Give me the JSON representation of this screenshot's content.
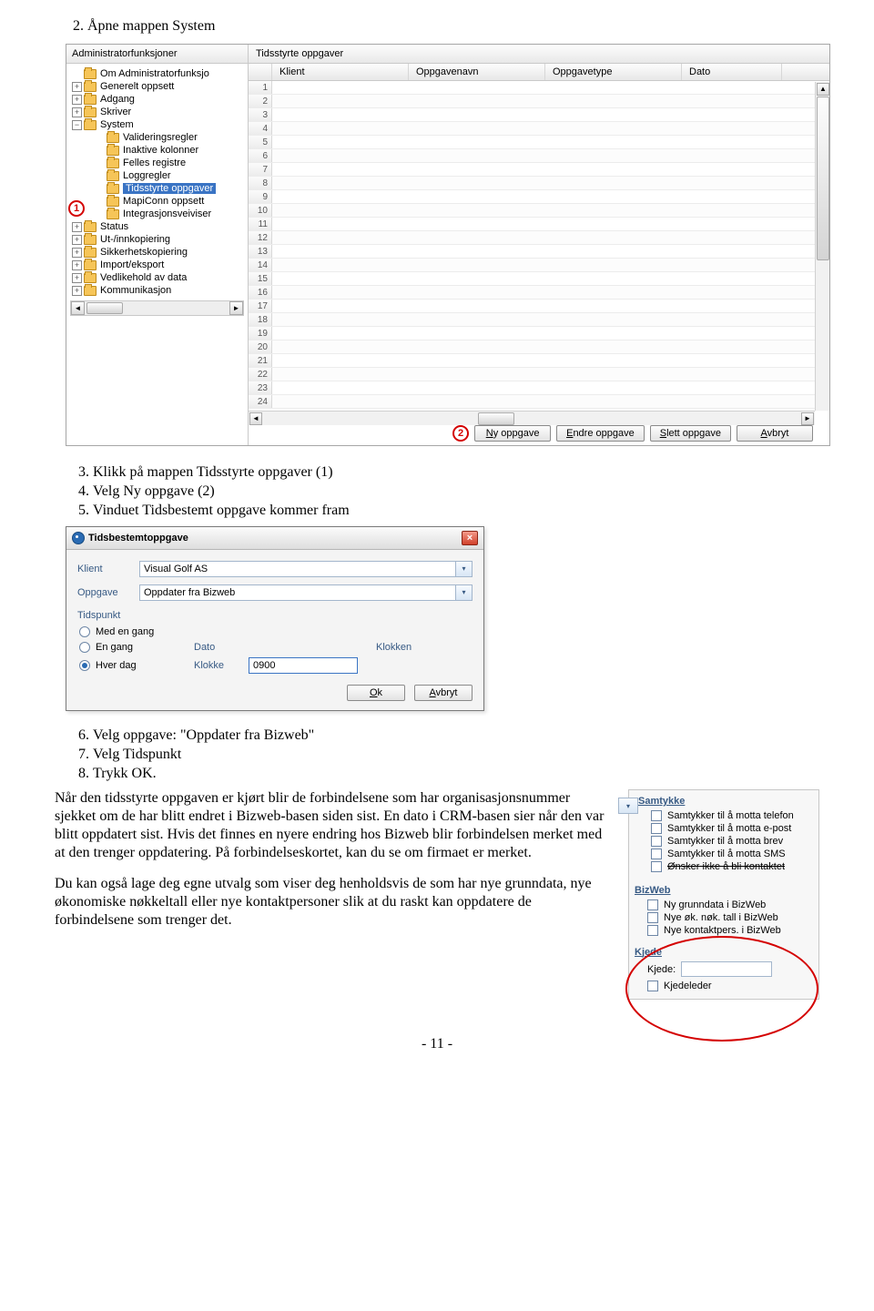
{
  "steps": {
    "s2": "2.   Åpne mappen System",
    "s3": "Klikk på mappen Tidsstyrte oppgaver (1)",
    "s4": "Velg Ny oppgave (2)",
    "s5": "Vinduet Tidsbestemt oppgave kommer fram",
    "s6": "Velg oppgave: \"Oppdater fra Bizweb\"",
    "s7": "Velg Tidspunkt",
    "s8": "Trykk OK."
  },
  "screenshot1": {
    "left_title": "Administratorfunksjoner",
    "right_title": "Tidsstyrte oppgaver",
    "tree": {
      "root": "Om Administratorfunksjo",
      "items": [
        {
          "exp": "+",
          "label": "Generelt oppsett"
        },
        {
          "exp": "+",
          "label": "Adgang"
        },
        {
          "exp": "+",
          "label": "Skriver"
        },
        {
          "exp": "-",
          "label": "System"
        }
      ],
      "system_children": [
        "Valideringsregler",
        "Inaktive kolonner",
        "Felles registre",
        "Loggregler",
        "Tidsstyrte oppgaver",
        "MapiConn oppsett",
        "Integrasjonsveiviser"
      ],
      "after_system": [
        {
          "exp": "+",
          "label": "Status"
        },
        {
          "exp": "+",
          "label": "Ut-/innkopiering"
        },
        {
          "exp": "+",
          "label": "Sikkerhetskopiering"
        },
        {
          "exp": "+",
          "label": "Import/eksport"
        },
        {
          "exp": "+",
          "label": "Vedlikehold av data"
        },
        {
          "exp": "+",
          "label": "Kommunikasjon"
        }
      ],
      "selected_index": 4,
      "badge1": "1"
    },
    "grid": {
      "columns": [
        "Klient",
        "Oppgavenavn",
        "Oppgavetype",
        "Dato"
      ],
      "row_count": 24,
      "badge2": "2"
    },
    "buttons": {
      "new": "Ny oppgave",
      "edit": "Endre oppgave",
      "delete": "Slett oppgave",
      "cancel": "Avbryt"
    }
  },
  "dialog": {
    "title": "Tidsbestemtoppgave",
    "klient_label": "Klient",
    "klient_value": "Visual Golf AS",
    "oppgave_label": "Oppgave",
    "oppgave_value": "Oppdater fra Bizweb",
    "section": "Tidspunkt",
    "radios": {
      "r1": "Med en gang",
      "r2": "En gang",
      "r3": "Hver dag"
    },
    "dato_label": "Dato",
    "klokken_label": "Klokken",
    "klokke_label": "Klokke",
    "klokke_value": "0900",
    "ok": "Ok",
    "cancel": "Avbryt"
  },
  "prose": {
    "p1": "Når den tidsstyrte oppgaven er kjørt blir de forbindelsene som har organisasjonsnummer sjekket om de har blitt endret i Bizweb-basen siden sist. En dato i CRM-basen sier når den var blitt oppdatert sist. Hvis det finnes en nyere endring hos Bizweb blir forbindelsen merket med at den trenger oppdatering. På forbindelseskortet, kan du se om firmaet er merket.",
    "p2": "Du kan også lage deg egne utvalg som viser deg henholdsvis de som har nye grunndata, nye økonomiske nøkkeltall eller nye kontaktpersoner slik at du raskt kan oppdatere de forbindelsene som trenger det."
  },
  "right_panel": {
    "samtykke_title": "Samtykke",
    "samtykke": [
      "Samtykker til å motta telefon",
      "Samtykker til å motta e-post",
      "Samtykker til å motta brev",
      "Samtykker til å motta SMS",
      "Ønsker ikke å bli kontaktet"
    ],
    "bizweb_title": "BizWeb",
    "bizweb": [
      "Ny grunndata i BizWeb",
      "Nye øk. nøk. tall i BizWeb",
      "Nye kontaktpers. i BizWeb"
    ],
    "kjede_title": "Kjede",
    "kjede_label": "Kjede:",
    "kjedeleder": "Kjedeleder"
  },
  "footer": "- 11 -"
}
